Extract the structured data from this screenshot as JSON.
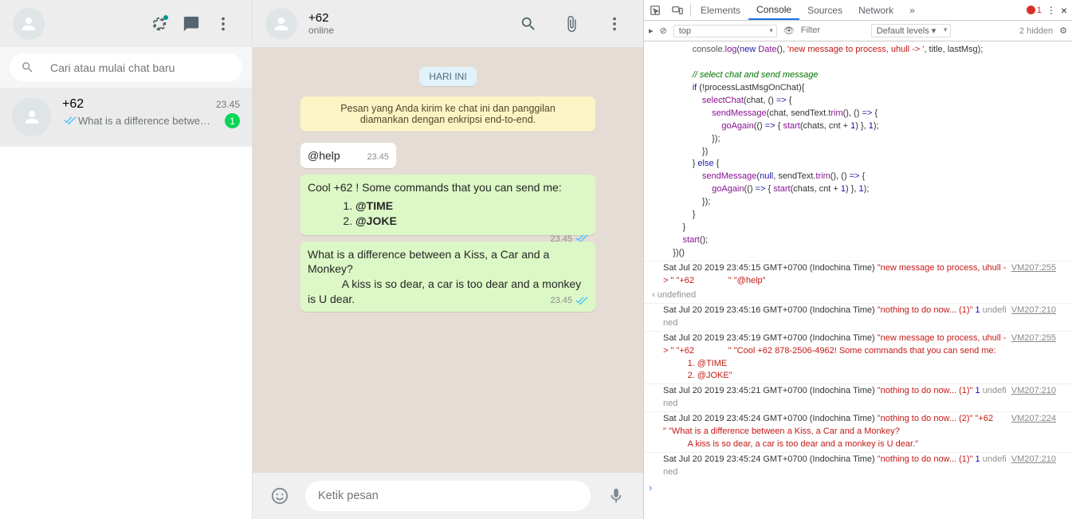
{
  "sidebar": {
    "search_placeholder": "Cari atau mulai chat baru",
    "chat": {
      "name": "+62",
      "time": "23.45",
      "preview": "What is a difference betwe…",
      "unread": "1"
    }
  },
  "chat": {
    "title": "+62",
    "status": "online",
    "date_label": "HARI INI",
    "encryption_notice": "Pesan yang Anda kirim ke chat ini dan panggilan diamankan dengan enkripsi end-to-end.",
    "msg_in_1": "@help",
    "msg_in_1_time": "23.45",
    "msg_out_1_line1": "Cool +62                          ! Some commands that you can send me:",
    "msg_out_1_cmd1": "@TIME",
    "msg_out_1_cmd2": "@JOKE",
    "msg_out_1_time": "23.45",
    "msg_out_2": "What is a difference between a Kiss, a Car and a Monkey?\n           A kiss is so dear, a car is too dear and a monkey is U dear.",
    "msg_out_2_time": "23.45",
    "compose_placeholder": "Ketik pesan"
  },
  "devtools": {
    "tabs": {
      "elements": "Elements",
      "console": "Console",
      "sources": "Sources",
      "network": "Network"
    },
    "error_count": "1",
    "context": "top",
    "filter_placeholder": "Filter",
    "levels": "Default levels ▾",
    "hidden": "2 hidden",
    "code": "            console.log(new Date(), 'new message to process, uhull -> ', title, lastMsg);\n\n            // select chat and send message\n            if (!processLastMsgOnChat){\n                selectChat(chat, () => {\n                    sendMessage(chat, sendText.trim(), () => {\n                        goAgain(() => { start(chats, cnt + 1) }, 1);\n                    });\n                })\n            } else {\n                sendMessage(null, sendText.trim(), () => {\n                    goAgain(() => { start(chats, cnt + 1) }, 1);\n                });\n            }\n        }\n        start();\n    })()",
    "log1_src": "VM207:255",
    "log1": "Sat Jul 20 2019 23:45:15 GMT+0700 (Indochina Time) \"new message to process, uhull -> \" \"+62              \" \"@help\"",
    "undef": "undefined",
    "log2_src": "VM207:210",
    "log2a": "Sat Jul 20 2019 23:45:16 GMT+0700 (Indochina Time) ",
    "log2b": "\"nothing to do now... (1)\"",
    "log2c": " 1 undefined",
    "log3_src": "VM207:255",
    "log3": "Sat Jul 20 2019 23:45:19 GMT+0700 (Indochina Time) \"new message to process, uhull -> \" \"+62              \" \"Cool +62 878-2506-4962! Some commands that you can send me:\n          1. @TIME\n          2. @JOKE\"",
    "log4_src": "VM207:210",
    "log4a": "Sat Jul 20 2019 23:45:21 GMT+0700 (Indochina Time) ",
    "log4b": "\"nothing to do now... (1)\"",
    "log4c": " 1 undefined",
    "log5_src": "VM207:224",
    "log5": "Sat Jul 20 2019 23:45:24 GMT+0700 (Indochina Time) \"nothing to do now... (2)\" \"+62              \" \"What is a difference between a Kiss, a Car and a Monkey?\n          A kiss is so dear, a car is too dear and a monkey is U dear.\"",
    "log6_src": "VM207:210",
    "log6a": "Sat Jul 20 2019 23:45:24 GMT+0700 (Indochina Time) ",
    "log6b": "\"nothing to do now... (1)\"",
    "log6c": " 1 undefined"
  }
}
